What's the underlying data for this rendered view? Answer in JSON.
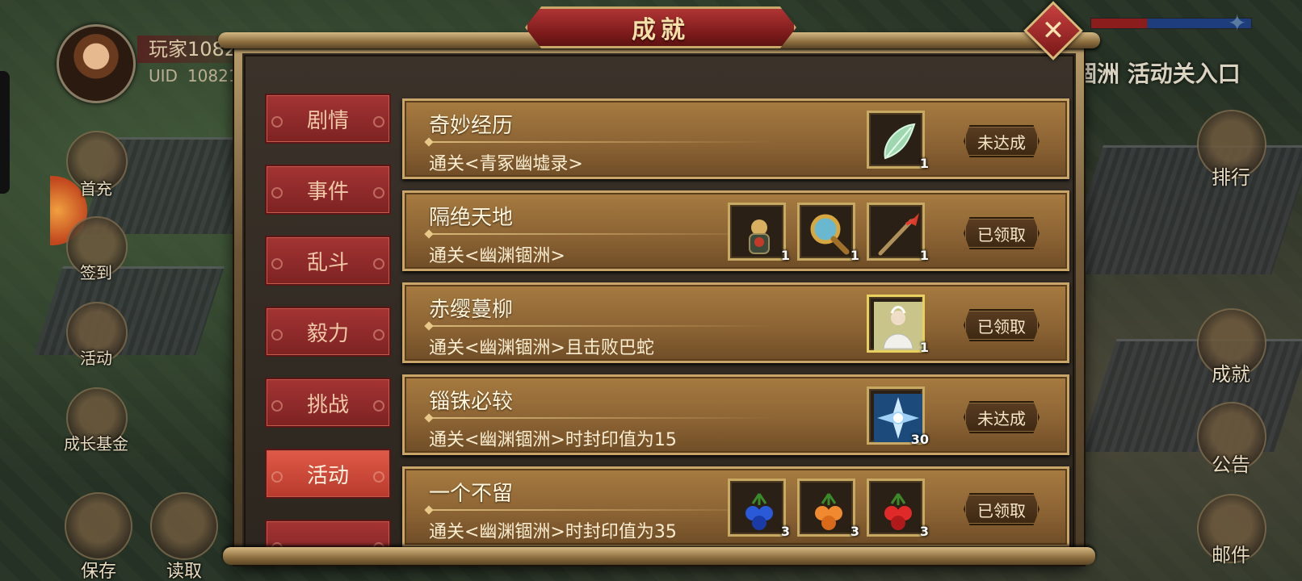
{
  "dialog": {
    "title": "成就",
    "close_label": "✕"
  },
  "player": {
    "name": "玩家1082",
    "uid_label": "UID",
    "uid_value": "10821"
  },
  "left_menu": [
    {
      "label": "首充"
    },
    {
      "label": "签到"
    },
    {
      "label": "活动"
    },
    {
      "label": "成长基金"
    }
  ],
  "right_header": {
    "entry_text": "涸洲 活动关入口"
  },
  "right_menu": [
    {
      "label": "排行",
      "icon_char": "榜"
    },
    {
      "label": "成就"
    },
    {
      "label": "公告"
    },
    {
      "label": "邮件"
    }
  ],
  "bottom_menu": [
    {
      "label": "保存"
    },
    {
      "label": "读取"
    }
  ],
  "tabs": [
    {
      "label": "剧情",
      "active": false
    },
    {
      "label": "事件",
      "active": false
    },
    {
      "label": "乱斗",
      "active": false
    },
    {
      "label": "毅力",
      "active": false
    },
    {
      "label": "挑战",
      "active": false
    },
    {
      "label": "活动",
      "active": true
    }
  ],
  "achievements": [
    {
      "title": "奇妙经历",
      "desc": "通关<青冢幽墟录>",
      "status": "未达成",
      "rewards": [
        {
          "icon": "green-leaf-icon",
          "count": "1"
        }
      ]
    },
    {
      "title": "隔绝天地",
      "desc": "通关<幽渊锢洲>",
      "status": "已领取",
      "rewards": [
        {
          "icon": "armor-figure-icon",
          "count": "1"
        },
        {
          "icon": "magnifying-mirror-icon",
          "count": "1"
        },
        {
          "icon": "spear-icon",
          "count": "1"
        }
      ]
    },
    {
      "title": "赤缨蔓柳",
      "desc": "通关<幽渊锢洲>且击败巴蛇",
      "status": "已领取",
      "rewards": [
        {
          "icon": "character-portrait-icon",
          "count": "1"
        }
      ]
    },
    {
      "title": "锱铢必较",
      "desc": "通关<幽渊锢洲>时封印值为15",
      "status": "未达成",
      "rewards": [
        {
          "icon": "ice-crystal-icon",
          "count": "30"
        }
      ]
    },
    {
      "title": "一个不留",
      "desc": "通关<幽渊锢洲>时封印值为35",
      "status": "已领取",
      "rewards": [
        {
          "icon": "blue-berry-icon",
          "count": "3"
        },
        {
          "icon": "orange-berry-icon",
          "count": "3"
        },
        {
          "icon": "red-berry-icon",
          "count": "3"
        }
      ]
    }
  ]
}
